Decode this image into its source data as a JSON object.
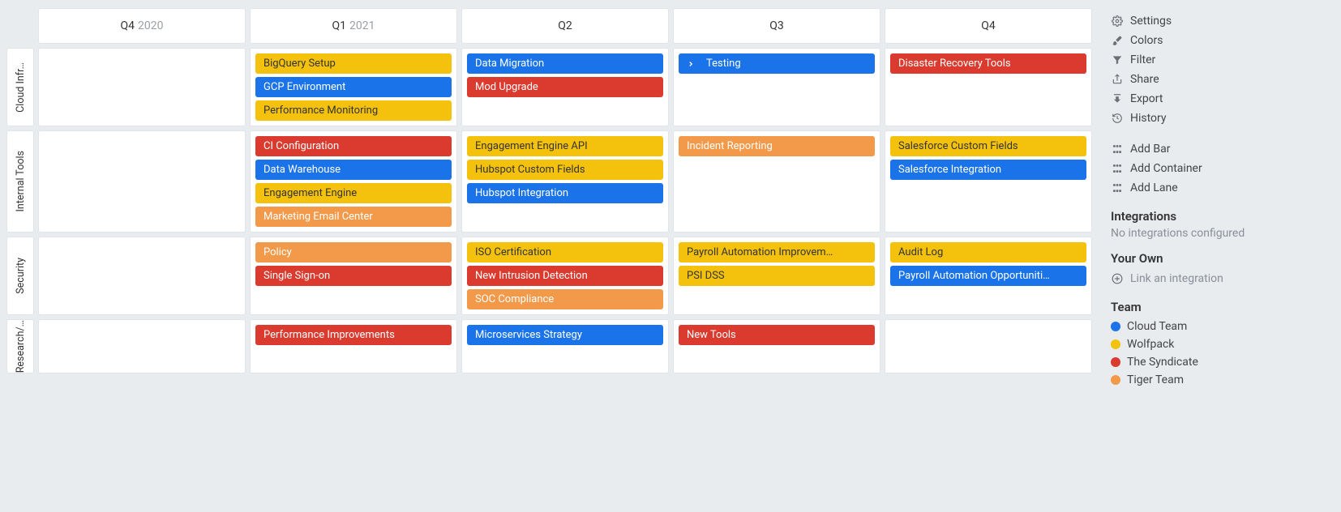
{
  "columns": [
    {
      "q": "Q4",
      "year": "2020"
    },
    {
      "q": "Q1",
      "year": "2021"
    },
    {
      "q": "Q2",
      "year": ""
    },
    {
      "q": "Q3",
      "year": ""
    },
    {
      "q": "Q4",
      "year": ""
    }
  ],
  "lanes": [
    {
      "label": "Cloud Infr…"
    },
    {
      "label": "Internal Tools"
    },
    {
      "label": "Security"
    },
    {
      "label": "Research/…"
    }
  ],
  "cells": {
    "0": {
      "1": [
        {
          "label": "BigQuery Setup",
          "color": "yellow"
        },
        {
          "label": "GCP Environment",
          "color": "blue"
        },
        {
          "label": "Performance Monitoring",
          "color": "yellow"
        }
      ],
      "2": [
        {
          "label": "Data Migration",
          "color": "blue"
        },
        {
          "label": "Mod Upgrade",
          "color": "red"
        }
      ],
      "3": [
        {
          "label": "Testing",
          "color": "blue",
          "expandable": true
        }
      ],
      "4": [
        {
          "label": "Disaster Recovery Tools",
          "color": "red"
        }
      ]
    },
    "1": {
      "1": [
        {
          "label": "CI Configuration",
          "color": "red"
        },
        {
          "label": "Data Warehouse",
          "color": "blue"
        },
        {
          "label": "Engagement Engine",
          "color": "yellow"
        },
        {
          "label": "Marketing Email Center",
          "color": "orange"
        }
      ],
      "2": [
        {
          "label": "Engagement Engine API",
          "color": "yellow"
        },
        {
          "label": "Hubspot Custom Fields",
          "color": "yellow"
        },
        {
          "label": "Hubspot Integration",
          "color": "blue"
        }
      ],
      "3": [
        {
          "label": "Incident Reporting",
          "color": "orange"
        }
      ],
      "4": [
        {
          "label": "Salesforce Custom Fields",
          "color": "yellow"
        },
        {
          "label": "Salesforce Integration",
          "color": "blue"
        }
      ]
    },
    "2": {
      "1": [
        {
          "label": "Policy",
          "color": "orange"
        },
        {
          "label": "Single Sign-on",
          "color": "red"
        }
      ],
      "2": [
        {
          "label": "ISO Certification",
          "color": "yellow"
        },
        {
          "label": "New Intrusion Detection",
          "color": "red"
        },
        {
          "label": "SOC Compliance",
          "color": "orange"
        }
      ],
      "3": [
        {
          "label": "Payroll Automation Improvem…",
          "color": "yellow"
        },
        {
          "label": "PSI DSS",
          "color": "yellow"
        }
      ],
      "4": [
        {
          "label": "Audit Log",
          "color": "yellow"
        },
        {
          "label": "Payroll Automation Opportuniti…",
          "color": "blue"
        }
      ]
    },
    "3": {
      "1": [
        {
          "label": "Performance Improvements",
          "color": "red"
        }
      ],
      "2": [
        {
          "label": "Microservices Strategy",
          "color": "blue"
        }
      ],
      "3": [
        {
          "label": "New Tools",
          "color": "red"
        }
      ],
      "4": []
    }
  },
  "sidebar": {
    "settings": "Settings",
    "colors": "Colors",
    "filter": "Filter",
    "share": "Share",
    "export": "Export",
    "history": "History",
    "add_bar": "Add Bar",
    "add_container": "Add Container",
    "add_lane": "Add Lane",
    "integrations_title": "Integrations",
    "no_integrations": "No integrations configured",
    "your_own_title": "Your Own",
    "link_integration": "Link an integration",
    "team_title": "Team",
    "teams": [
      {
        "name": "Cloud Team",
        "color": "blue"
      },
      {
        "name": "Wolfpack",
        "color": "yellow"
      },
      {
        "name": "The Syndicate",
        "color": "red"
      },
      {
        "name": "Tiger Team",
        "color": "orange"
      }
    ]
  }
}
